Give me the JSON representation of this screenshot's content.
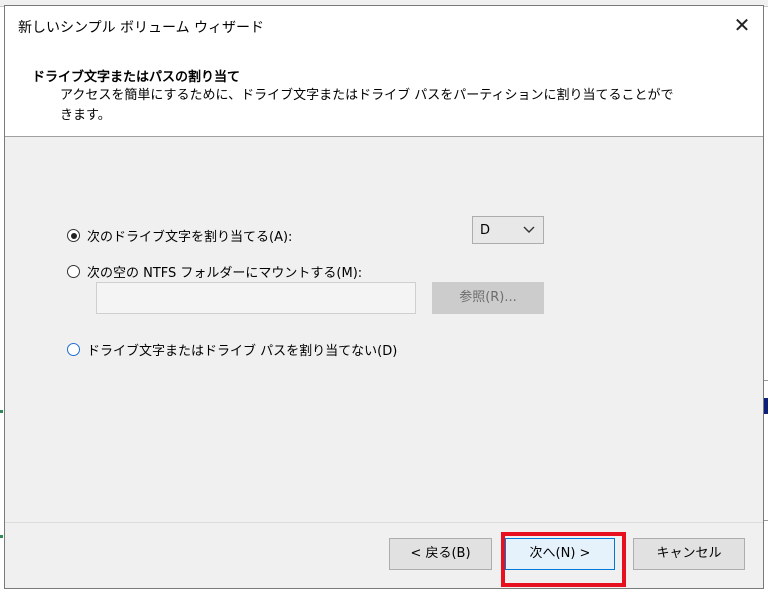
{
  "dialog": {
    "title": "新しいシンプル ボリューム ウィザード",
    "close_glyph": "✕"
  },
  "header": {
    "title": "ドライブ文字またはパスの割り当て",
    "description": "アクセスを簡単にするために、ドライブ文字またはドライブ パスをパーティションに割り当てることができます。"
  },
  "options": {
    "assign_letter": {
      "label": "次のドライブ文字を割り当てる(A):",
      "checked": true
    },
    "mount_folder": {
      "label": "次の空の NTFS フォルダーにマウントする(M):",
      "checked": false
    },
    "no_assign": {
      "label": "ドライブ文字またはドライブ パスを割り当てない(D)",
      "checked": false
    }
  },
  "drive_letter": {
    "selected": "D",
    "icon": "chevron-down-icon"
  },
  "folder_path": {
    "value": ""
  },
  "browse_button": {
    "label": "参照(R)..."
  },
  "footer": {
    "back_label": "< 戻る(B)",
    "next_label": "次へ(N) >",
    "cancel_label": "キャンセル"
  },
  "colors": {
    "highlight": "#e8101f",
    "focus": "#0078d7"
  }
}
